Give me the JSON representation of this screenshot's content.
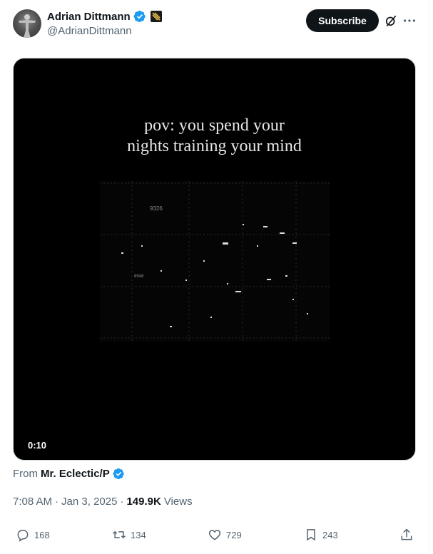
{
  "author": {
    "display_name": "Adrian Dittmann",
    "handle": "@AdrianDittmann",
    "verified_color": "#1d9bf0"
  },
  "header": {
    "subscribe_label": "Subscribe",
    "icons": [
      "grok-icon",
      "more-icon"
    ]
  },
  "media": {
    "caption_line1": "pov: you spend your",
    "caption_line2": "nights training your mind",
    "viz_label_1": "9326",
    "viz_label_2": "8548",
    "duration": "0:10"
  },
  "source": {
    "prefix": "From",
    "name": "Mr. Eclectic/P"
  },
  "meta": {
    "time": "7:08 AM",
    "sep1": "·",
    "date": "Jan 3, 2025",
    "sep2": "·",
    "views_count": "149.9K",
    "views_label": "Views"
  },
  "actions": {
    "replies": "168",
    "reposts": "134",
    "likes": "729",
    "bookmarks": "243"
  }
}
